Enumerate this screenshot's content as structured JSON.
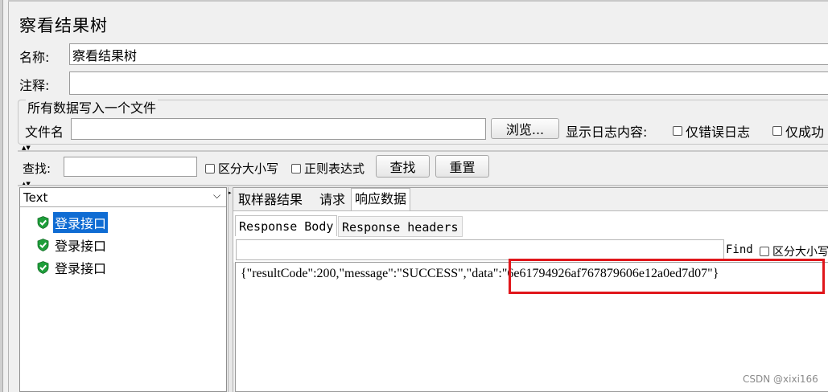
{
  "window": {
    "title": "察看结果树"
  },
  "form": {
    "name_label": "名称:",
    "name_value": "察看结果树",
    "comment_label": "注释:",
    "comment_value": ""
  },
  "file_group": {
    "title": "所有数据写入一个文件",
    "filename_label": "文件名",
    "filename_value": "",
    "browse_label": "浏览...",
    "log_content_label": "显示日志内容:",
    "errors_only_label": "仅错误日志",
    "success_only_label": "仅成功"
  },
  "search": {
    "label": "查找:",
    "value": "",
    "case_sensitive_label": "区分大小写",
    "regex_label": "正则表达式",
    "find_button": "查找",
    "reset_button": "重置"
  },
  "tree": {
    "renderer": "Text",
    "items": [
      {
        "label": "登录接口",
        "status": "success",
        "selected": true
      },
      {
        "label": "登录接口",
        "status": "success",
        "selected": false
      },
      {
        "label": "登录接口",
        "status": "success",
        "selected": false
      }
    ]
  },
  "result_tabs": [
    {
      "label": "取样器结果",
      "active": false
    },
    {
      "label": "请求",
      "active": false
    },
    {
      "label": "响应数据",
      "active": true
    }
  ],
  "response_tabs": [
    {
      "label": "Response Body",
      "active": true
    },
    {
      "label": "Response headers",
      "active": false
    }
  ],
  "response_find": {
    "value": "",
    "find_label": "Find",
    "case_label": "区分大小写"
  },
  "response_body": {
    "prefix": "{\"resultCode\":200,\"message\":\"SUCCESS\",",
    "highlighted": "\"data\":\"6e61794926af767879606e12a0ed7d07\"}"
  },
  "watermark": "CSDN @xixi166",
  "colors": {
    "selection": "#0f6cd3",
    "success_icon": "#1e9e3a",
    "highlight_box": "#e0161b"
  }
}
